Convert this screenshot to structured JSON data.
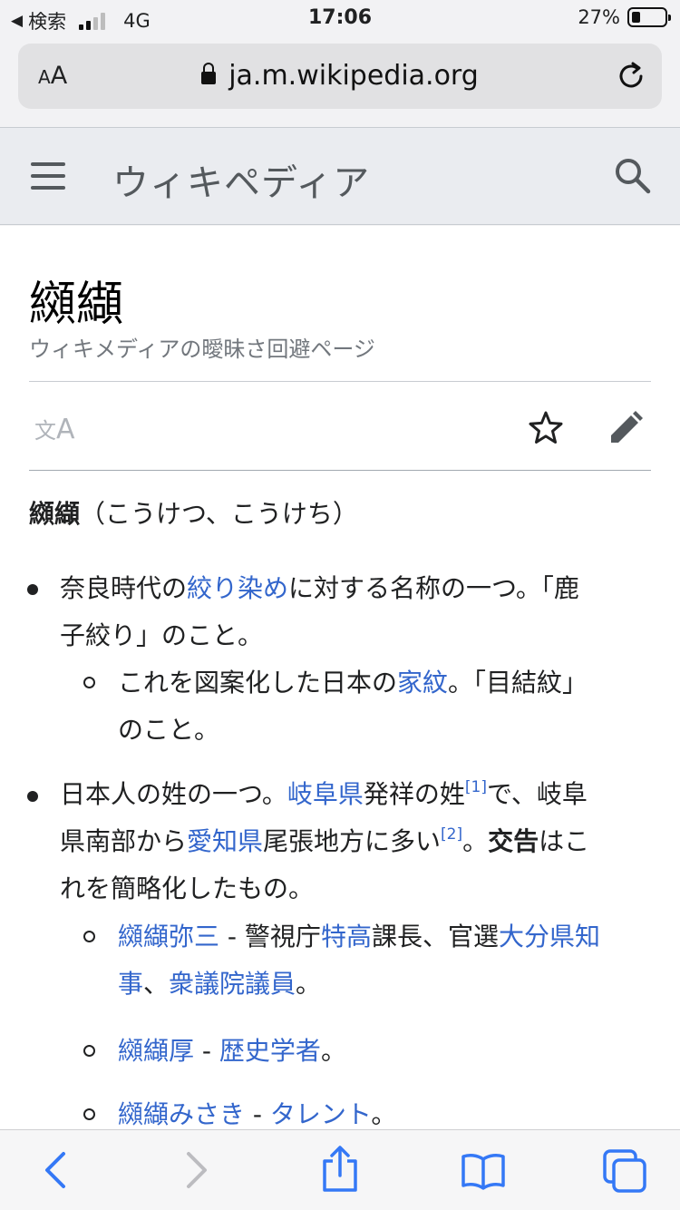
{
  "status_bar": {
    "back_app": "検索",
    "network": "4G",
    "time": "17:06",
    "battery": "27%",
    "battery_level": 0.27
  },
  "browser": {
    "text_size_small": "A",
    "text_size_large": "A",
    "url": "ja.m.wikipedia.org"
  },
  "header": {
    "site_title": "ウィキペディア"
  },
  "article": {
    "title": "纐纈",
    "tagline": "ウィキメディアの曖昧さ回避ページ",
    "lang_icon_1": "文",
    "lang_icon_2": "A",
    "lead_bold": "纐纈",
    "lead_rest": "（こうけつ、こうけち）",
    "item1": {
      "t1": "奈良時代の",
      "link1": "絞り染め",
      "t2": "に対する名称の一つ。「鹿",
      "t3": "子絞り」のこと。",
      "sub": {
        "t1": "これを図案化した日本の",
        "link1": "家紋",
        "t2": "。「目結紋」",
        "t3": "のこと。"
      }
    },
    "item2": {
      "t1": "日本人の姓の一つ。",
      "link1": "岐阜県",
      "t2": "発祥の姓",
      "ref1": "[1]",
      "t3": "で、岐阜",
      "t4": "県南部から",
      "link2": "愛知県",
      "t5": "尾張地方に多い",
      "ref2": "[2]",
      "t6": "。",
      "bold1": "交告",
      "t7": "はこ",
      "t8": "れを簡略化したもの。",
      "people": [
        {
          "name": "纐纈弥三",
          "sep": " - ",
          "d1": "警視庁",
          "d1_link": "特高",
          "d2": "課長、官選",
          "d2_link": "大分県知",
          "d3_link": "事",
          "d3": "、",
          "d4_link": "衆議院議員",
          "d4": "。"
        },
        {
          "name": "纐纈厚",
          "sep": " - ",
          "d1_link": "歴史学者",
          "d1": "。"
        },
        {
          "name": "纐纈みさき",
          "sep": " - ",
          "d1_link": "タレント",
          "d1": "。"
        }
      ]
    }
  },
  "colors": {
    "link": "#3366cc",
    "ios_blue": "#3478f6",
    "disabled": "#bcbcc0"
  },
  "icons": [
    "back-triangle-icon",
    "signal-icon",
    "lock-icon",
    "reload-icon",
    "menu-icon",
    "search-icon",
    "language-icon",
    "star-icon",
    "edit-icon",
    "back-icon",
    "forward-icon",
    "share-icon",
    "bookmarks-icon",
    "tabs-icon"
  ]
}
